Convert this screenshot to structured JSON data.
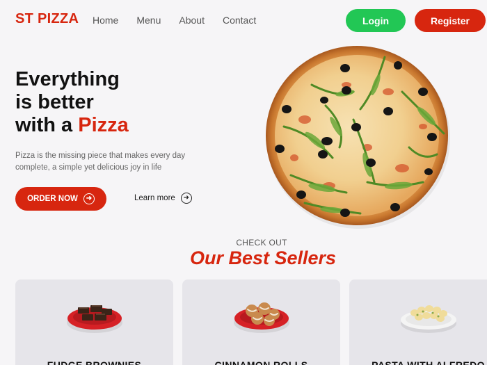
{
  "nav": {
    "logo": "ST PIZZA",
    "links": [
      "Home",
      "Menu",
      "About",
      "Contact"
    ],
    "login_label": "Login",
    "register_label": "Register"
  },
  "hero": {
    "title_line1": "Everything",
    "title_line2": "is better",
    "title_line3_prefix": "with a ",
    "title_line3_accent": "Pizza",
    "description": "Pizza is the missing piece that makes every day complete, a simple yet delicious joy in life",
    "order_label": "ORDER NOW",
    "learn_label": "Learn more"
  },
  "best_sellers": {
    "eyebrow": "CHECK OUT",
    "title": "Our Best Sellers",
    "items": [
      {
        "name": "FUDGE BROWNIES"
      },
      {
        "name": "CINNAMON ROLLS"
      },
      {
        "name": "PASTA WITH ALFREDO"
      }
    ]
  },
  "colors": {
    "brand_red": "#d7260f",
    "login_green": "#22c755",
    "background": "#f6f5f7",
    "card_bg": "#e6e5ea"
  },
  "icons": [
    "arrow-circle-right-icon"
  ]
}
